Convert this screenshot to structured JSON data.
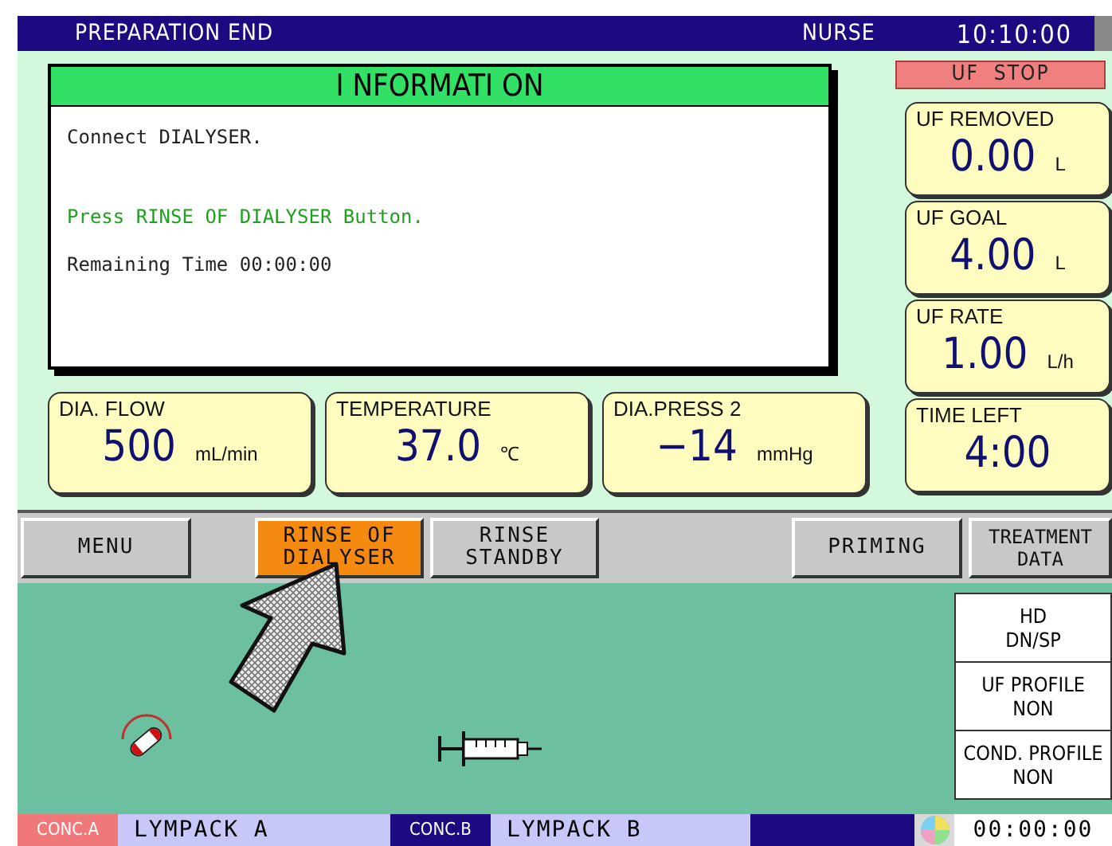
{
  "header": {
    "title": "PREPARATION END",
    "user": "NURSE",
    "time": "10:10:00"
  },
  "information": {
    "title": "I NFORMATI ON",
    "lines": [
      {
        "text": "Connect DIALYSER.",
        "kind": "normal"
      },
      {
        "text": "Press RINSE OF DIALYSER Button.",
        "kind": "highlight"
      },
      {
        "text": "Remaining Time  00:00:00",
        "kind": "normal"
      }
    ]
  },
  "uf_status": "UF  STOP",
  "side_readouts": [
    {
      "label": "UF REMOVED",
      "value": "0.00",
      "unit": "L"
    },
    {
      "label": "UF GOAL",
      "value": "4.00",
      "unit": "L"
    },
    {
      "label": "UF RATE",
      "value": "1.00",
      "unit": "L/h"
    },
    {
      "label": "TIME LEFT",
      "value": "4:00"
    }
  ],
  "bottom_readouts": [
    {
      "label": "DIA. FLOW",
      "value": "500",
      "unit": "mL/min"
    },
    {
      "label": "TEMPERATURE",
      "value": "37.0",
      "unit": "℃"
    },
    {
      "label": "DIA.PRESS 2",
      "value": "−14",
      "unit": "mmHg"
    }
  ],
  "buttons": [
    {
      "label": "MENU",
      "selected": false
    },
    {
      "label": "RINSE OF DIALYSER",
      "selected": true
    },
    {
      "label": "RINSE STANDBY",
      "selected": false
    },
    {
      "label": "PRIMING",
      "selected": false
    },
    {
      "label": "TREATMENT DATA",
      "selected": false
    }
  ],
  "profiles": [
    {
      "title": "HD",
      "value": "DN/SP"
    },
    {
      "title": "UF PROFILE",
      "value": "NON"
    },
    {
      "title": "COND. PROFILE",
      "value": "NON"
    }
  ],
  "concentrates": [
    {
      "label": "CONC.A",
      "name": "LYMPACK A",
      "color": "#f07878"
    },
    {
      "label": "CONC.B",
      "name": "LYMPACK B",
      "color": "#1e0a80"
    }
  ],
  "status_time": "00:00:00"
}
